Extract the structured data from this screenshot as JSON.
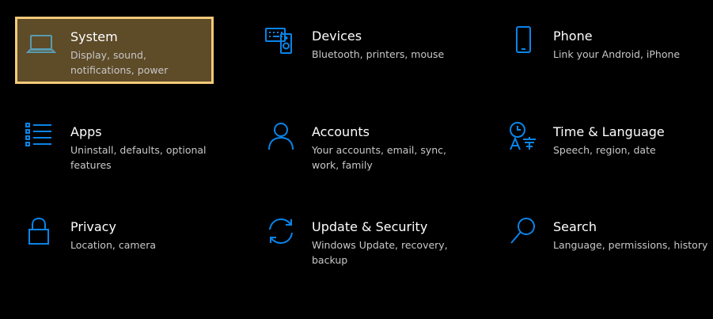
{
  "accent_color": "#0a84e8",
  "selected_bg": "#5e4b28",
  "selected_border": "#f3c97a",
  "tiles": [
    {
      "icon": "laptop-icon",
      "title": "System",
      "desc": "Display, sound, notifications, power"
    },
    {
      "icon": "keyboard-speaker-icon",
      "title": "Devices",
      "desc": "Bluetooth, printers, mouse"
    },
    {
      "icon": "phone-icon",
      "title": "Phone",
      "desc": "Link your Android, iPhone"
    },
    {
      "icon": "list-icon",
      "title": "Apps",
      "desc": "Uninstall, defaults, optional features"
    },
    {
      "icon": "person-icon",
      "title": "Accounts",
      "desc": "Your accounts, email, sync, work, family"
    },
    {
      "icon": "clock-language-icon",
      "title": "Time & Language",
      "desc": "Speech, region, date"
    },
    {
      "icon": "lock-icon",
      "title": "Privacy",
      "desc": "Location, camera"
    },
    {
      "icon": "refresh-icon",
      "title": "Update & Security",
      "desc": "Windows Update, recovery, backup"
    },
    {
      "icon": "search-icon",
      "title": "Search",
      "desc": "Language, permissions, history"
    }
  ]
}
